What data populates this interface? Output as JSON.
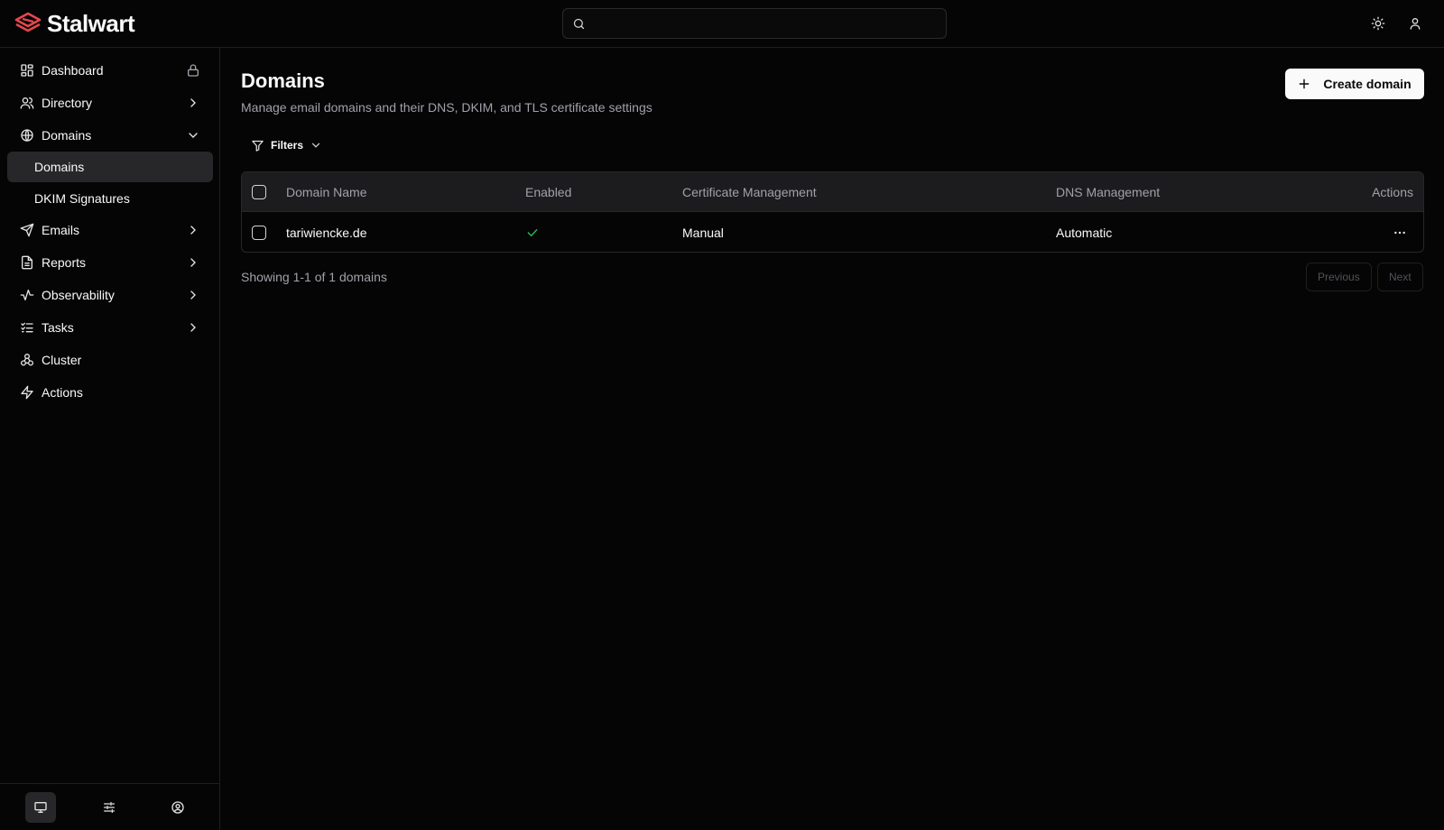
{
  "app": {
    "brand": "Stalwart"
  },
  "search": {
    "placeholder": ""
  },
  "sidebar": {
    "items": [
      {
        "label": "Dashboard"
      },
      {
        "label": "Directory"
      },
      {
        "label": "Domains"
      },
      {
        "label": "Emails"
      },
      {
        "label": "Reports"
      },
      {
        "label": "Observability"
      },
      {
        "label": "Tasks"
      },
      {
        "label": "Cluster"
      },
      {
        "label": "Actions"
      }
    ],
    "domains_sub": [
      {
        "label": "Domains",
        "active": true
      },
      {
        "label": "DKIM Signatures",
        "active": false
      }
    ]
  },
  "page": {
    "title": "Domains",
    "subtitle": "Manage email domains and their DNS, DKIM, and TLS certificate settings",
    "create_label": "Create domain",
    "filters_label": "Filters"
  },
  "table": {
    "columns": [
      "Domain Name",
      "Enabled",
      "Certificate Management",
      "DNS Management",
      "Actions"
    ],
    "rows": [
      {
        "domain": "tariwiencke.de",
        "enabled": true,
        "certificate": "Manual",
        "dns": "Automatic"
      }
    ]
  },
  "pagination": {
    "summary": "Showing 1-1 of 1 domains",
    "previous": "Previous",
    "next": "Next"
  },
  "colors": {
    "background": "#050505",
    "brand": "#e5484d",
    "enabled_check": "#22c55e",
    "active_item": "#27272a"
  }
}
